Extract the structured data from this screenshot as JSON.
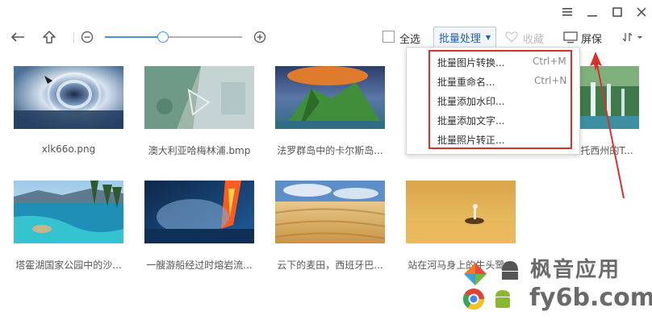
{
  "window": {
    "menu_icon": "menu-icon",
    "minimize_icon": "minimize-icon",
    "maximize_icon": "maximize-icon",
    "close_icon": "close-icon"
  },
  "toolbar": {
    "back_icon": "back-arrow-icon",
    "up_icon": "up-folder-icon",
    "zoom_out_icon": "zoom-out-icon",
    "zoom_in_icon": "zoom-in-icon",
    "zoom_level": 0.42,
    "select_all_label": "全选",
    "batch_label": "批量处理",
    "favorite_label": "收藏",
    "screensaver_label": "屏保",
    "sort_icon": "sort-icon"
  },
  "batch_menu": {
    "items": [
      {
        "label": "批量图片转换...",
        "shortcut": "Ctrl+M"
      },
      {
        "label": "批量重命名...",
        "shortcut": "Ctrl+N"
      },
      {
        "label": "批量添加水印...",
        "shortcut": ""
      },
      {
        "label": "批量添加文字...",
        "shortcut": ""
      },
      {
        "label": "批量照片转正...",
        "shortcut": ""
      }
    ]
  },
  "images": [
    {
      "name": "xlk66o.png"
    },
    {
      "name": "澳大利亚哈梅林浦.bmp"
    },
    {
      "name": "法罗群岛中的卡尔斯岛..."
    },
    {
      "name": ""
    },
    {
      "name": "波托西州的T..."
    },
    {
      "name": "塔霍湖国家公园中的沙..."
    },
    {
      "name": "一艘游船经过时熔岩流..."
    },
    {
      "name": "云下的麦田，西班牙巴..."
    },
    {
      "name": "站在河马身上的牛头鹭..."
    }
  ],
  "watermark": {
    "title": "枫音应用",
    "url": "fy6b.com"
  },
  "colors": {
    "accent": "#1f5fb5",
    "highlight_border": "#d9312b"
  }
}
